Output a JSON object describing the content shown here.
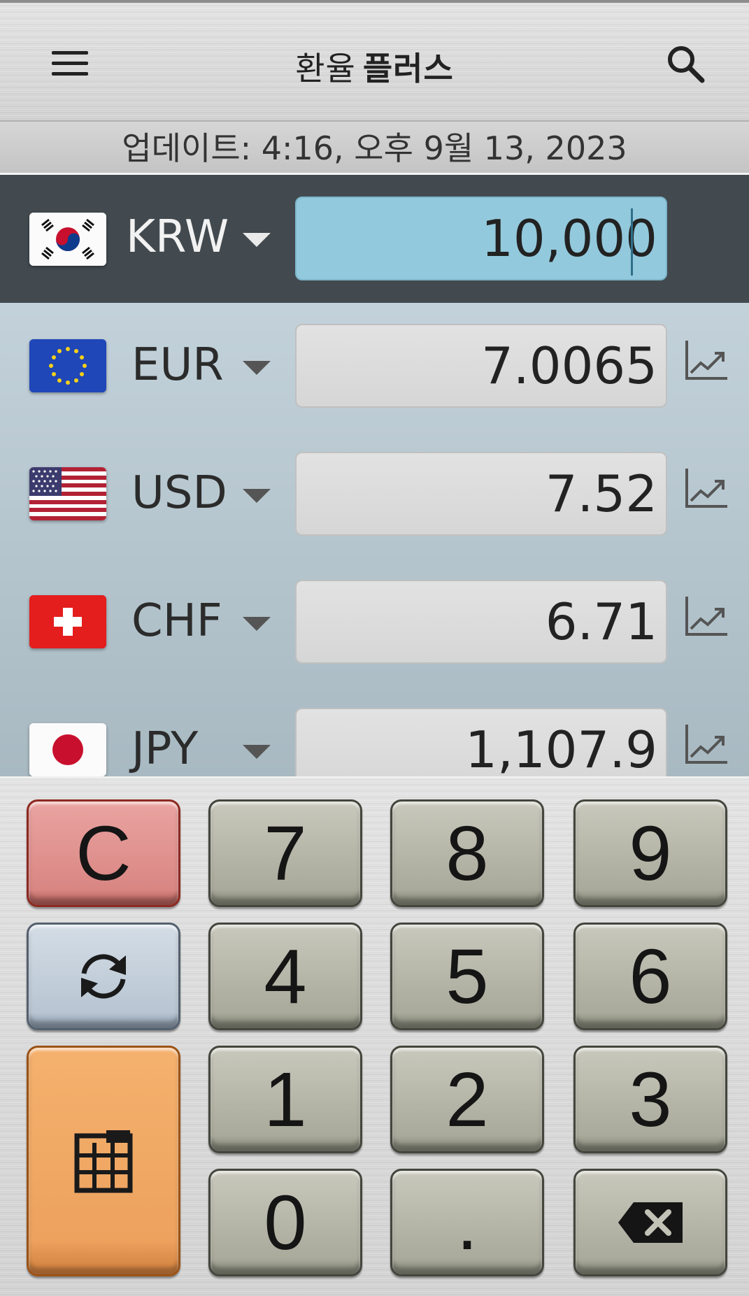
{
  "header": {
    "title_part1": "환율",
    "title_part2": "플러스",
    "menu_icon": "hamburger-menu-icon",
    "search_icon": "search-icon"
  },
  "update": {
    "text": "업데이트: 4:16, 오후 9월 13, 2023"
  },
  "base_currency": {
    "code": "KRW",
    "amount": "10,000",
    "flag": "south-korea-flag"
  },
  "currencies": [
    {
      "code": "EUR",
      "amount": "7.0065",
      "flag": "eu-flag"
    },
    {
      "code": "USD",
      "amount": "7.52",
      "flag": "usa-flag"
    },
    {
      "code": "CHF",
      "amount": "6.71",
      "flag": "switzerland-flag"
    },
    {
      "code": "JPY",
      "amount": "1,107.9",
      "flag": "japan-flag"
    }
  ],
  "keypad": {
    "clear": "C",
    "k7": "7",
    "k8": "8",
    "k9": "9",
    "k4": "4",
    "k5": "5",
    "k6": "6",
    "k1": "1",
    "k2": "2",
    "k3": "3",
    "k0": "0",
    "dot": ".",
    "swap_icon": "refresh-icon",
    "calc_icon": "calculator-icon",
    "backspace_icon": "backspace-icon"
  },
  "colors": {
    "base_row_bg": "#424a4f",
    "active_input": "#93c9dc",
    "clear_key": "#d98683",
    "calc_key": "#eda25e",
    "swap_key": "#b8c5d2"
  }
}
